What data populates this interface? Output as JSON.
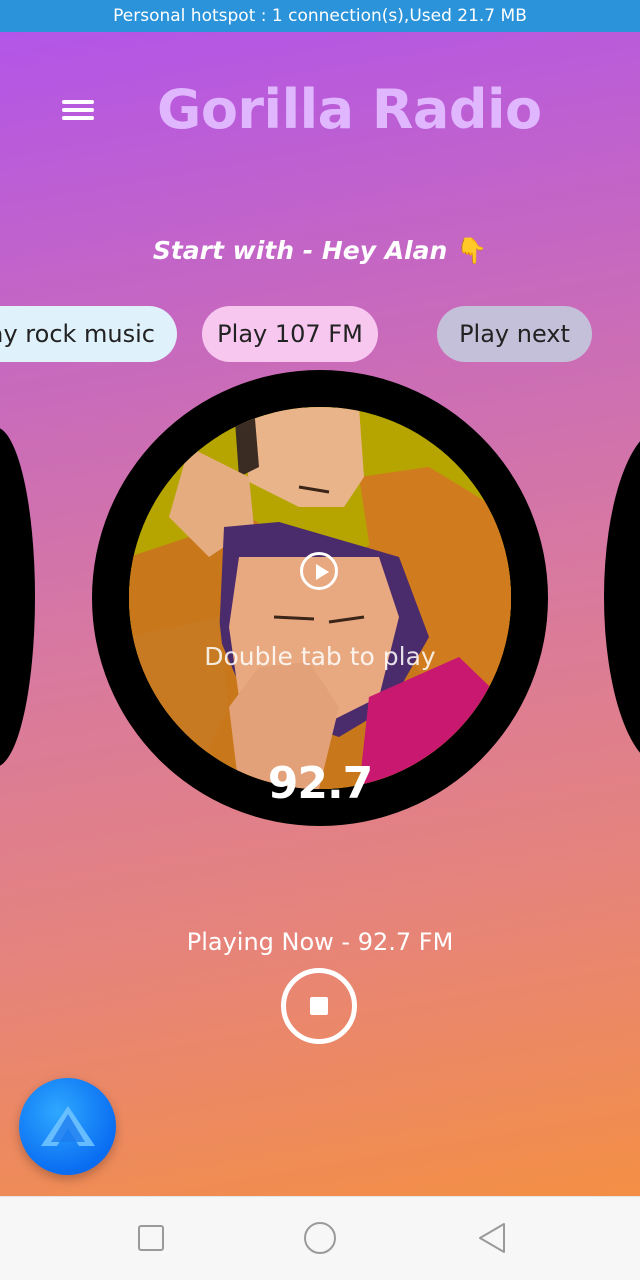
{
  "status_bar": {
    "text": "Personal hotspot : 1 connection(s),Used  21.7 MB"
  },
  "header": {
    "title": "Gorilla Radio"
  },
  "prompt": {
    "text": "Start with - Hey Alan",
    "emoji": "👇"
  },
  "suggestions": [
    {
      "label": "ay rock music"
    },
    {
      "label": "Play 107 FM"
    },
    {
      "label": "Play next"
    }
  ],
  "station_disc": {
    "hint": "Double tab to play",
    "frequency": "92.7"
  },
  "player": {
    "now_playing": "Playing Now - 92.7 FM"
  },
  "icons": {
    "menu": "hamburger-menu-icon",
    "play": "play-circle-icon",
    "stop": "stop-icon",
    "assistant": "alan-assistant-icon",
    "nav_recent": "square-icon",
    "nav_home": "circle-icon",
    "nav_back": "triangle-back-icon"
  },
  "colors": {
    "status_bar": "#2a93d9",
    "title": "#e0b7ff",
    "gradient_top": "#b355e8",
    "gradient_bottom": "#f48f45",
    "assistant": "#0a6ef2"
  }
}
